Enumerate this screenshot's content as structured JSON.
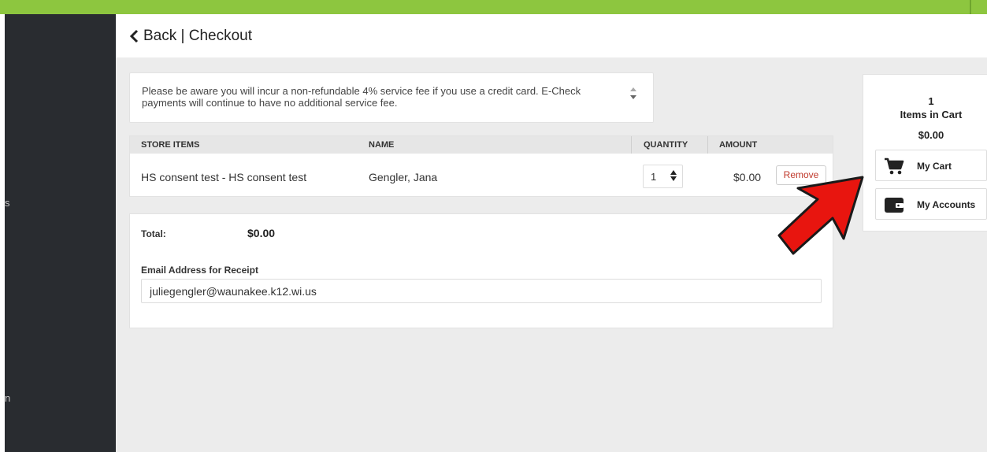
{
  "header": {
    "title": "Back | Checkout"
  },
  "sidebar": {
    "fragments": [
      "s",
      "n"
    ]
  },
  "notice": {
    "text": "Please be aware you will incur a non-refundable 4% service fee if you use a credit card. E-Check payments will continue to have no additional service fee."
  },
  "table": {
    "columns": [
      "STORE ITEMS",
      "NAME",
      "QUANTITY",
      "AMOUNT"
    ],
    "rows": [
      {
        "store_item": "HS consent test - HS consent test",
        "name": "Gengler, Jana",
        "quantity": "1",
        "amount": "$0.00",
        "action": "Remove"
      }
    ]
  },
  "totals": {
    "label": "Total:",
    "value": "$0.00"
  },
  "email": {
    "label": "Email Address for Receipt",
    "value": "juliegengler@waunakee.k12.wi.us"
  },
  "cart": {
    "count": "1",
    "label": "Items in Cart",
    "total": "$0.00",
    "my_cart_label": "My Cart",
    "my_accounts_label": "My Accounts"
  },
  "colors": {
    "accent": "#8dc63f",
    "sidebar": "#292c30",
    "remove": "#c0392b",
    "arrow": "#e8150f"
  },
  "icons": [
    "chevron-left-icon",
    "shopping-cart-icon",
    "wallet-icon",
    "arrow-annotation"
  ]
}
